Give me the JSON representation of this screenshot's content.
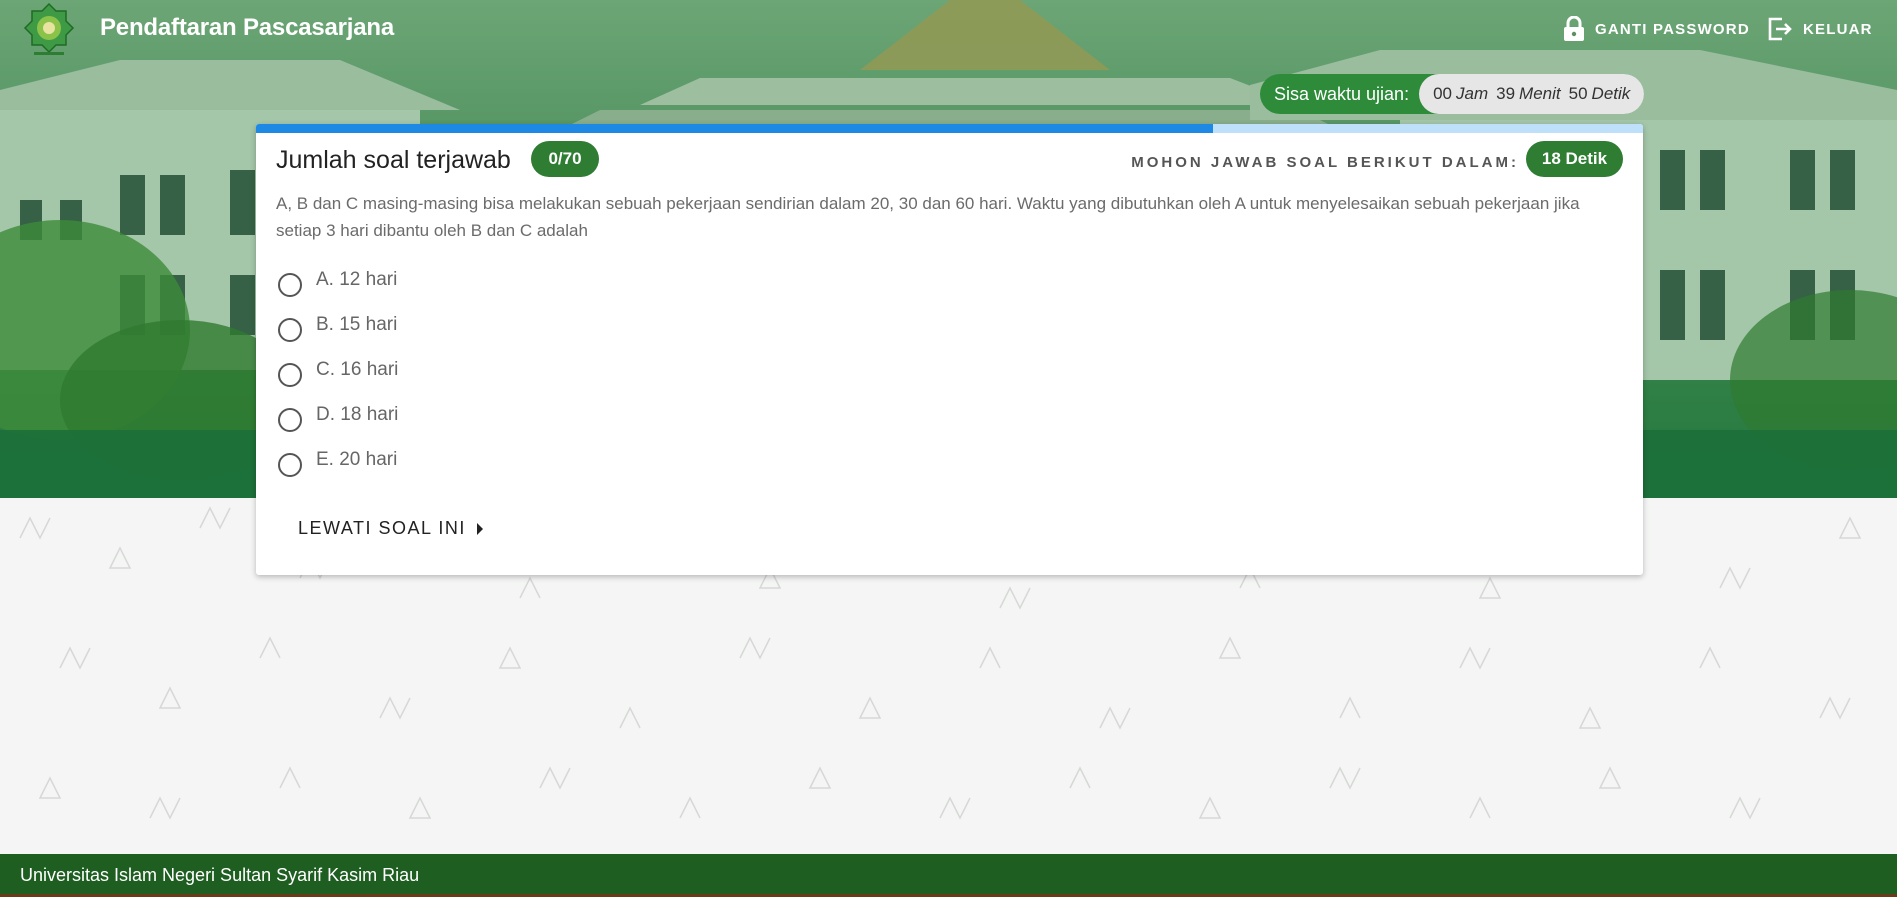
{
  "header": {
    "app_title": "Pendaftaran Pascasarjana",
    "logo_icon": "uin-suska-logo",
    "change_password_label": "GANTI PASSWORD",
    "logout_label": "KELUAR"
  },
  "timer": {
    "label": "Sisa waktu ujian:",
    "hours": "00",
    "hours_unit": "Jam",
    "minutes": "39",
    "minutes_unit": "Menit",
    "seconds": "50",
    "seconds_unit": "Detik"
  },
  "quiz": {
    "progress_fraction": 0.69,
    "title": "Jumlah soal terjawab",
    "answered_count": "0/70",
    "answer_within_label": "MOHON JAWAB SOAL BERIKUT DALAM:",
    "answer_within_value": "18 Detik",
    "question_text": "A, B dan C masing-masing bisa melakukan sebuah pekerjaan sendirian dalam 20, 30 dan 60 hari. Waktu yang dibutuhkan oleh A untuk menyelesaikan sebuah pekerjaan jika setiap 3 hari dibantu oleh B dan C adalah",
    "options": [
      {
        "label": "A. 12 hari"
      },
      {
        "label": "B. 15 hari"
      },
      {
        "label": "C. 16 hari"
      },
      {
        "label": "D. 18 hari"
      },
      {
        "label": "E. 20 hari"
      }
    ],
    "skip_label": "LEWATI SOAL INI"
  },
  "footer": {
    "text": "Universitas Islam Negeri Sultan Syarif Kasim Riau"
  },
  "colors": {
    "primary_green": "#2e7d32",
    "progress_blue": "#1e88e5",
    "footer_green": "#1e5e21"
  }
}
